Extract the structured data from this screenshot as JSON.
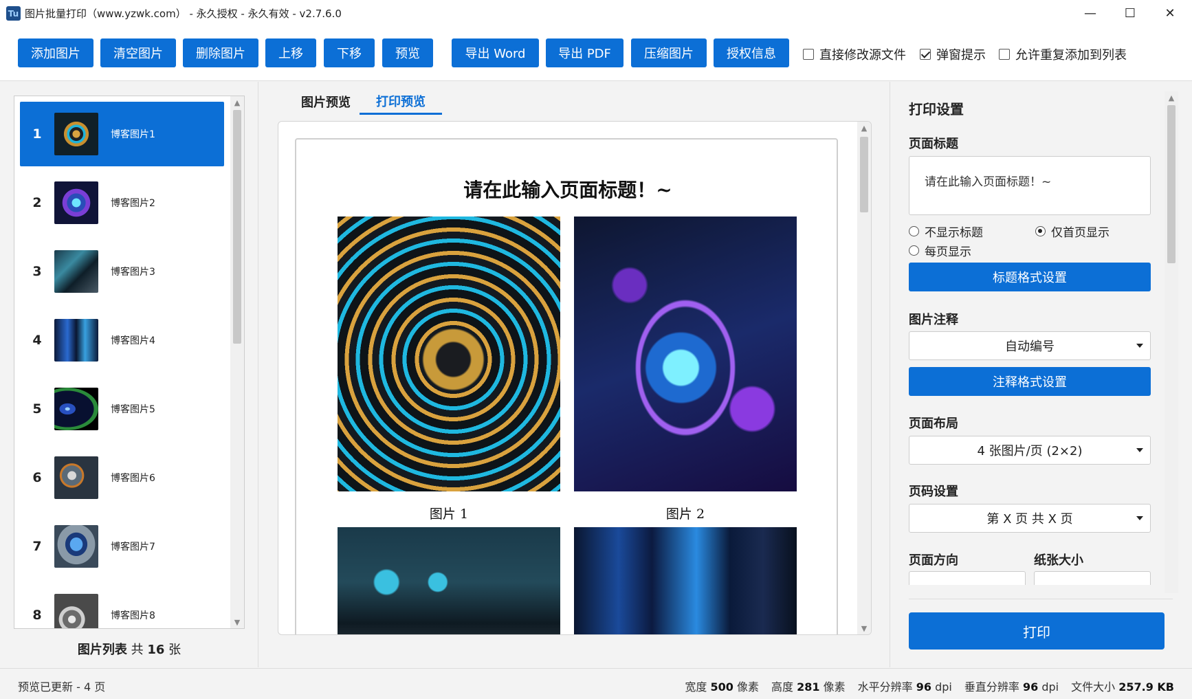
{
  "window": {
    "app_icon_text": "Tu",
    "title": "图片批量打印（www.yzwk.com） - 永久授权 - 永久有效 - v2.7.6.0",
    "minimize": "—",
    "maximize": "☐",
    "close": "✕"
  },
  "toolbar": {
    "buttons": [
      "添加图片",
      "清空图片",
      "删除图片",
      "上移",
      "下移",
      "预览",
      "导出 Word",
      "导出 PDF",
      "压缩图片",
      "授权信息"
    ],
    "checkboxes": [
      {
        "label": "直接修改源文件",
        "checked": false
      },
      {
        "label": "弹窗提示",
        "checked": true
      },
      {
        "label": "允许重复添加到列表",
        "checked": false
      }
    ]
  },
  "image_list": {
    "items": [
      {
        "num": "1",
        "label": "博客图片1",
        "selected": true
      },
      {
        "num": "2",
        "label": "博客图片2",
        "selected": false
      },
      {
        "num": "3",
        "label": "博客图片3",
        "selected": false
      },
      {
        "num": "4",
        "label": "博客图片4",
        "selected": false
      },
      {
        "num": "5",
        "label": "博客图片5",
        "selected": false
      },
      {
        "num": "6",
        "label": "博客图片6",
        "selected": false
      },
      {
        "num": "7",
        "label": "博客图片7",
        "selected": false
      },
      {
        "num": "8",
        "label": "博客图片8",
        "selected": false
      }
    ],
    "footer_label": "图片列表",
    "footer_prefix": "共",
    "footer_count": "16",
    "footer_unit": "张"
  },
  "preview": {
    "tabs": [
      {
        "label": "图片预览",
        "active": false
      },
      {
        "label": "打印预览",
        "active": true
      }
    ],
    "page_title": "请在此输入页面标题！~",
    "captions": [
      "图片 1",
      "图片 2"
    ]
  },
  "settings": {
    "header": "打印设置",
    "page_title_label": "页面标题",
    "page_title_value": "请在此输入页面标题！~",
    "title_options": [
      {
        "label": "不显示标题",
        "checked": false
      },
      {
        "label": "仅首页显示",
        "checked": true
      },
      {
        "label": "每页显示",
        "checked": false
      }
    ],
    "title_format_button": "标题格式设置",
    "annotation_label": "图片注释",
    "annotation_value": "自动编号",
    "annotation_format_button": "注释格式设置",
    "layout_label": "页面布局",
    "layout_value": "4 张图片/页 (2×2)",
    "page_number_label": "页码设置",
    "page_number_value": "第 X 页 共 X 页",
    "orientation_label": "页面方向",
    "paper_size_label": "纸张大小",
    "print_button": "打印"
  },
  "status": {
    "left": "预览已更新 - 4 页",
    "width_label": "宽度",
    "width_value": "500",
    "width_unit": "像素",
    "height_label": "高度",
    "height_value": "281",
    "height_unit": "像素",
    "hres_label": "水平分辨率",
    "hres_value": "96",
    "hres_unit": "dpi",
    "vres_label": "垂直分辨率",
    "vres_value": "96",
    "vres_unit": "dpi",
    "size_label": "文件大小",
    "size_value": "257.9 KB"
  },
  "colors": {
    "accent": "#0c6fd6"
  },
  "icons": {
    "minimize": "minimize-icon",
    "maximize": "maximize-icon",
    "close": "close-icon",
    "dropdown": "chevron-down-icon"
  }
}
